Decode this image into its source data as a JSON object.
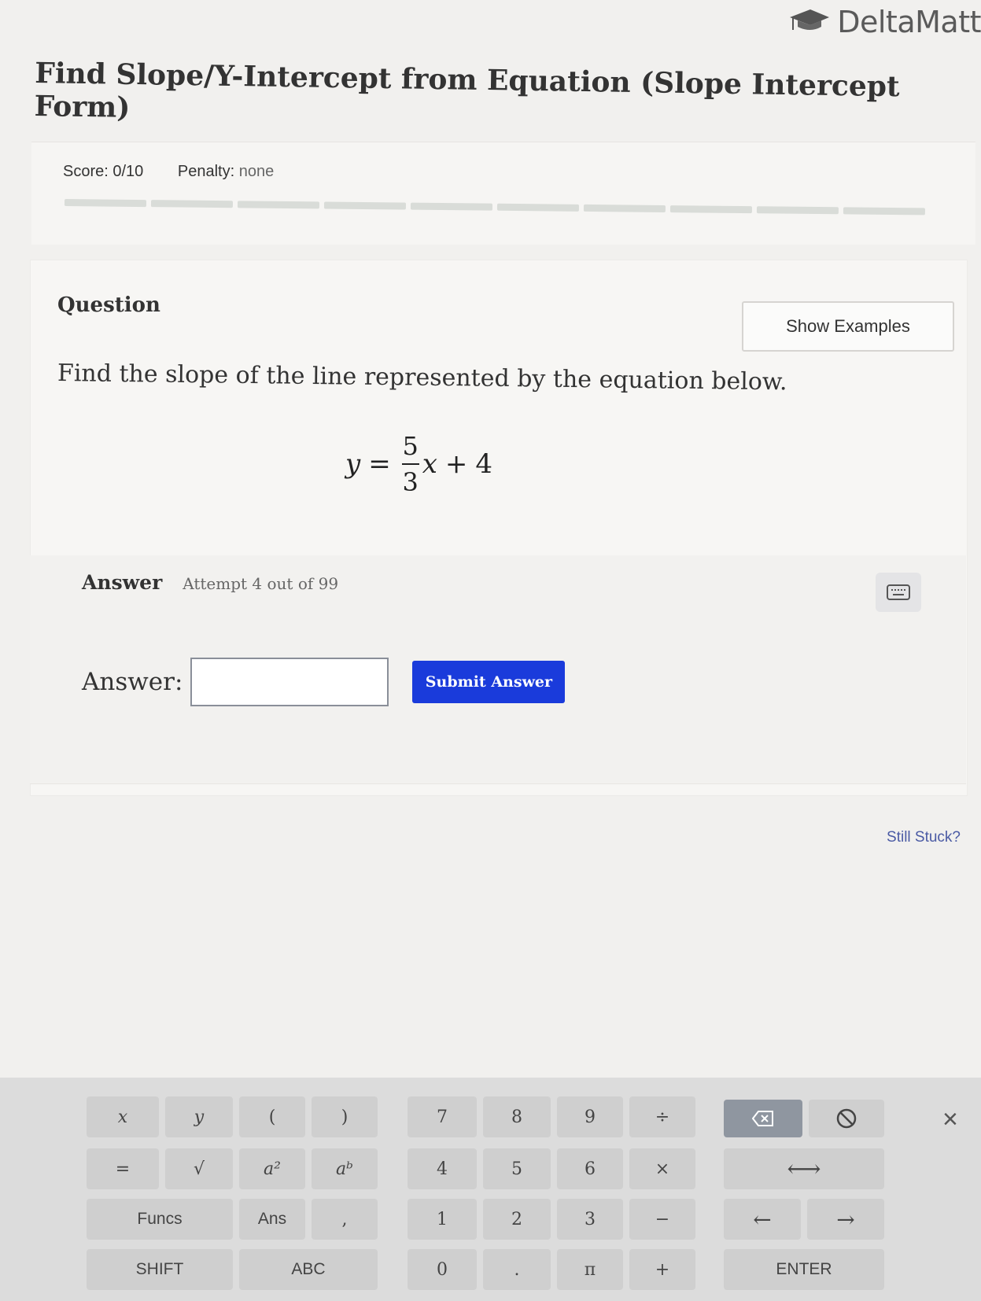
{
  "brand": {
    "name": "DeltaMatt",
    "icon": "graduation-cap-icon"
  },
  "page_title": "Find Slope/Y-Intercept from Equation (Slope Intercept Form)",
  "score": {
    "label": "Score:",
    "value": "0/10",
    "penalty_label": "Penalty:",
    "penalty_value": "none",
    "progress_segments": 10,
    "progress_filled": 0
  },
  "question": {
    "heading": "Question",
    "show_examples": "Show Examples",
    "prompt": "Find the slope of the line represented by the equation below.",
    "equation": {
      "lhs": "y",
      "eq": "=",
      "numerator": "5",
      "denominator": "3",
      "var": "x",
      "op": "+",
      "const": "4"
    }
  },
  "answer": {
    "heading": "Answer",
    "attempt": "Attempt 4 out of 99",
    "label": "Answer:",
    "value": "",
    "submit": "Submit Answer",
    "keyboard_icon": "keyboard-icon"
  },
  "still_stuck": "Still Stuck?",
  "keypad": {
    "row1": [
      "x",
      "y",
      "(",
      ")",
      "7",
      "8",
      "9",
      "÷"
    ],
    "row2": [
      "=",
      "√",
      "a²",
      "aᵇ",
      "4",
      "5",
      "6",
      "×"
    ],
    "row3": [
      "Funcs",
      "Ans",
      ",",
      "1",
      "2",
      "3",
      "−"
    ],
    "row4": [
      "SHIFT",
      "ABC",
      "0",
      ".",
      "π",
      "+"
    ],
    "backspace_icon": "backspace-icon",
    "clear_icon": "clear-icon",
    "swap": "⟷",
    "left": "←",
    "right": "→",
    "enter": "ENTER",
    "close": "×"
  }
}
